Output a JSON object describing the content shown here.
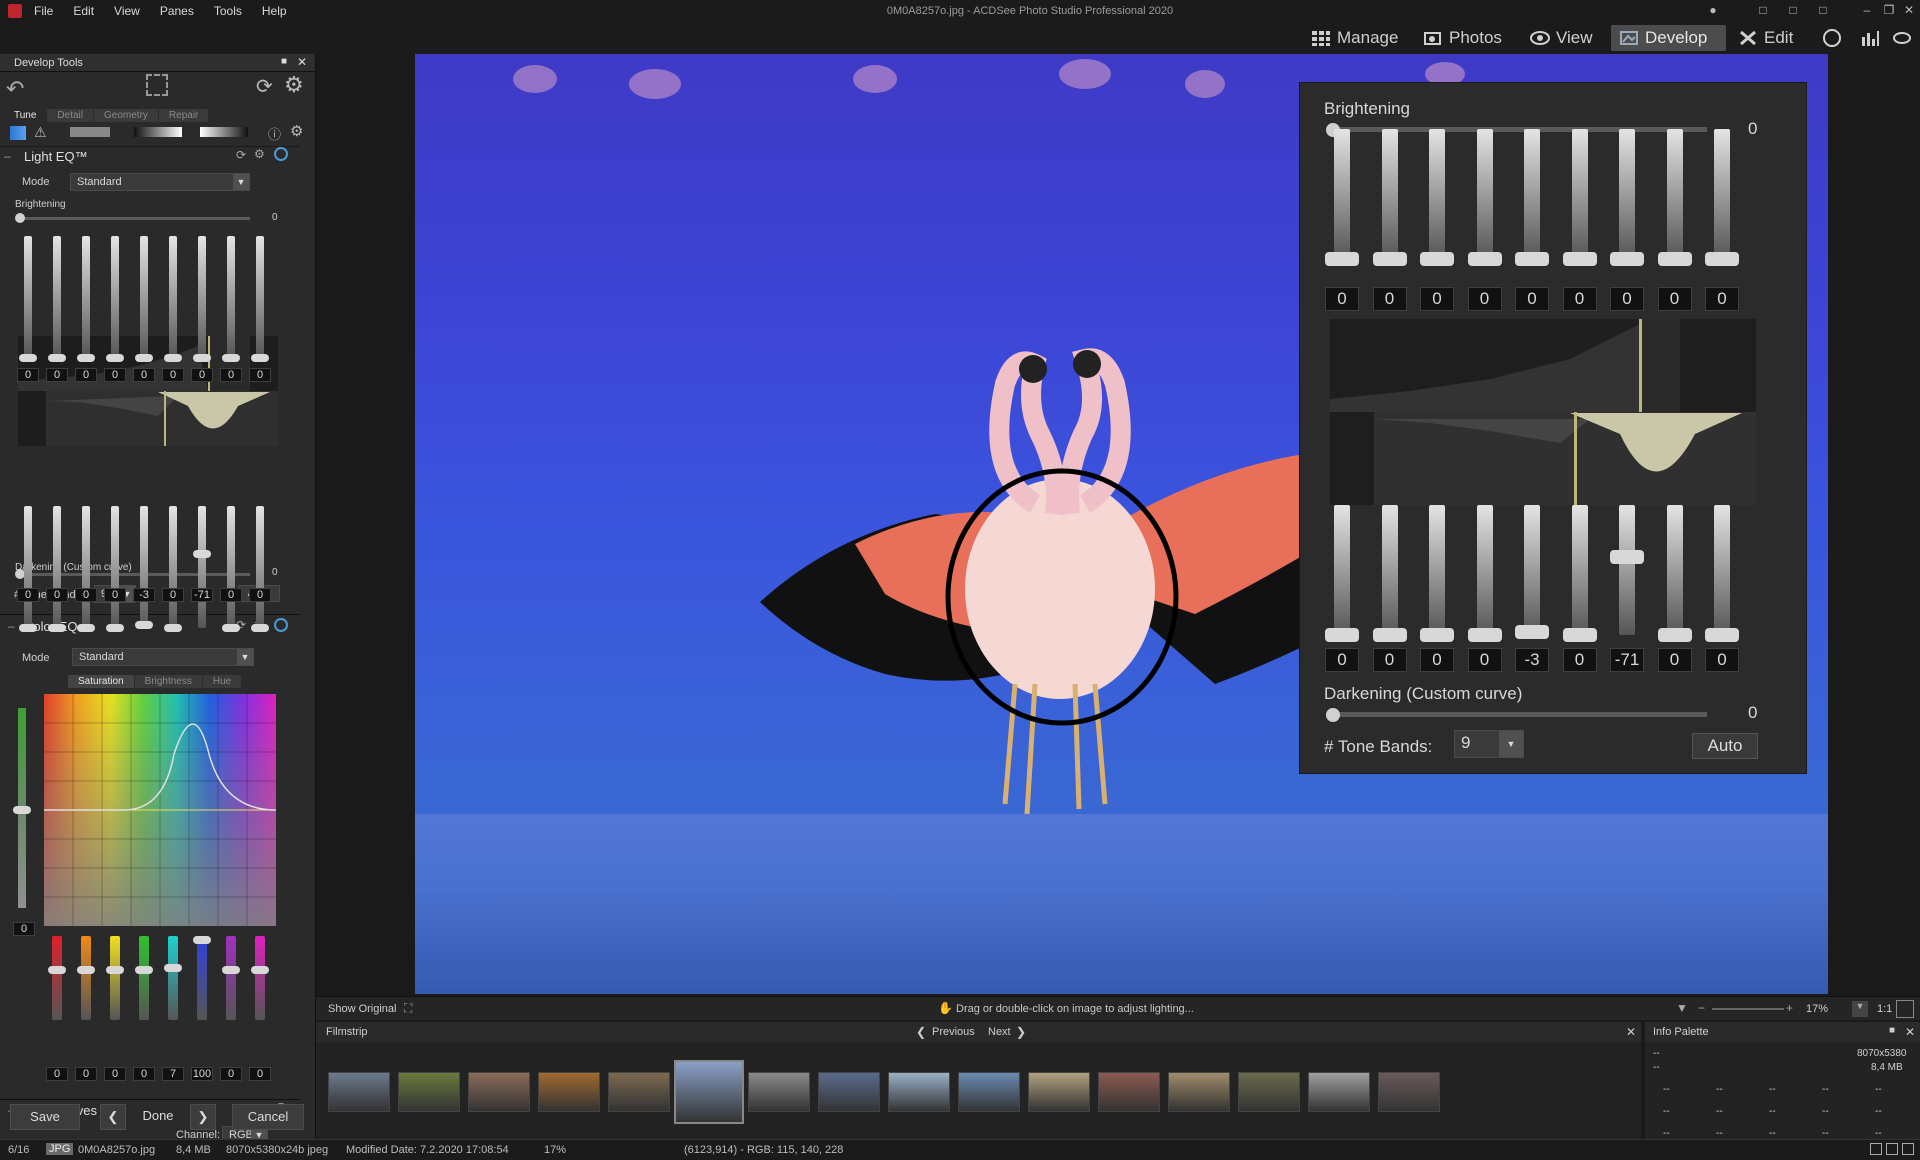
{
  "window": {
    "title": "0M0A8257o.jpg - ACDSee Photo Studio Professional 2020",
    "menu": [
      "File",
      "Edit",
      "View",
      "Panes",
      "Tools",
      "Help"
    ]
  },
  "modes": {
    "manage": "Manage",
    "photos": "Photos",
    "view": "View",
    "develop": "Develop",
    "edit": "Edit"
  },
  "develop_tools": {
    "panel_title": "Develop Tools",
    "tabs": [
      "Tune",
      "Detail",
      "Geometry",
      "Repair"
    ],
    "active_tab": "Tune",
    "light_eq": {
      "title": "Light EQ™",
      "mode_label": "Mode",
      "mode_value": "Standard",
      "brightening_label": "Brightening",
      "brightening_value": "0",
      "top_band_values": [
        "0",
        "0",
        "0",
        "0",
        "0",
        "0",
        "0",
        "0",
        "0"
      ],
      "bottom_band_values": [
        "0",
        "0",
        "0",
        "0",
        "-3",
        "0",
        "-71",
        "0",
        "0"
      ],
      "darkening_label": "Darkening (Custom curve)",
      "darkening_value": "0",
      "tone_bands_label": "# Tone Bands:",
      "tone_bands_value": "9",
      "auto_label": "Auto"
    },
    "color_eq": {
      "title": "Color EQ",
      "mode_label": "Mode",
      "mode_value": "Standard",
      "subtabs": [
        "Saturation",
        "Brightness",
        "Hue"
      ],
      "active_subtab": "Saturation",
      "side_value": "0",
      "channel_values": [
        "0",
        "0",
        "0",
        "0",
        "7",
        "100",
        "0",
        "0"
      ],
      "channel_colors": [
        "#e0202a",
        "#f08a18",
        "#f0e020",
        "#30c030",
        "#20d0d0",
        "#3040e0",
        "#a030c0",
        "#e020c0"
      ]
    },
    "tone_curves": {
      "title": "Tone Curves",
      "channel_label": "Channel:",
      "channel_value": "RGB"
    },
    "buttons": {
      "save": "Save",
      "done": "Done",
      "cancel": "Cancel"
    }
  },
  "zoom_panel": {
    "brightening_label": "Brightening",
    "brightening_value": "0",
    "top_band_values": [
      "0",
      "0",
      "0",
      "0",
      "0",
      "0",
      "0",
      "0",
      "0"
    ],
    "bottom_band_values": [
      "0",
      "0",
      "0",
      "0",
      "-3",
      "0",
      "-71",
      "0",
      "0"
    ],
    "darkening_label": "Darkening (Custom curve)",
    "darkening_value": "0",
    "tone_bands_label": "# Tone Bands:",
    "tone_bands_value": "9",
    "auto_label": "Auto"
  },
  "image_bar": {
    "show_original": "Show Original",
    "hint": "Drag or double-click on image to adjust lighting...",
    "zoom": "17%",
    "one_to_one": "1:1"
  },
  "filmstrip": {
    "title": "Filmstrip",
    "previous": "Previous",
    "next": "Next",
    "thumb_colors": [
      "#6b7a8c",
      "#6a7a3c",
      "#8c6c5a",
      "#a06a30",
      "#7c6a50",
      "#8aa0c8",
      "#8a8a8a",
      "#5a6c8c",
      "#9ab0c8",
      "#6a8ab0",
      "#b0a080",
      "#8c5a50",
      "#a08c6a",
      "#6a6a4c",
      "#a0a0a0",
      "#6a5a5c"
    ]
  },
  "info_palette": {
    "title": "Info Palette",
    "resolution": "8070x5380",
    "size": "8,4 MB",
    "placeholder": "--"
  },
  "status": {
    "index": "6/16",
    "format": "JPG",
    "filename": "0M0A8257o.jpg",
    "filesize": "8,4 MB",
    "dims": "8070x5380x24b jpeg",
    "modified": "Modified Date: 7.2.2020 17:08:54",
    "zoom": "17%",
    "pixel": "(6123,914) - RGB: 115, 140, 228"
  }
}
